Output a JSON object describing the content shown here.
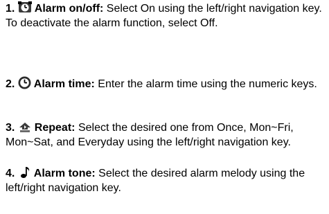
{
  "items": [
    {
      "number": "1.",
      "icon": "alarm-clock-icon",
      "heading": "Alarm on/off:",
      "text": "Select On using the left/right navigation key.",
      "note": "To deactivate the alarm function, select Off."
    },
    {
      "number": "2.",
      "icon": "clock-icon",
      "heading": "Alarm time:",
      "text": "Enter the alarm time using the numeric keys."
    },
    {
      "number": "3.",
      "icon": "repeat-icon",
      "heading": "Repeat:",
      "text": "Select the desired one from Once, Mon~Fri, Mon~Sat, and Everyday using the left/right navigation key."
    },
    {
      "number": "4.",
      "icon": "music-note-icon",
      "heading": "Alarm tone:",
      "text": "Select the desired alarm melody using the left/right navigation key."
    }
  ]
}
